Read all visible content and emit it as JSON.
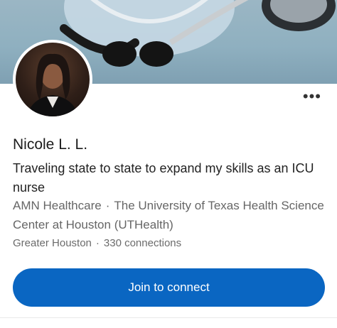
{
  "profile": {
    "name": "Nicole L. L.",
    "headline": "Traveling state to state to expand my skills as an ICU nurse",
    "company": "AMN Healthcare",
    "school": "The University of Texas Health Science Center at Houston (UTHealth)",
    "location": "Greater Houston",
    "connections": "330 connections"
  },
  "actions": {
    "more": "•••",
    "join": "Join to connect"
  },
  "colors": {
    "primary_button": "#0a66c2",
    "banner": "#8fb0c0"
  },
  "icons": {
    "more": "ellipsis-icon"
  }
}
